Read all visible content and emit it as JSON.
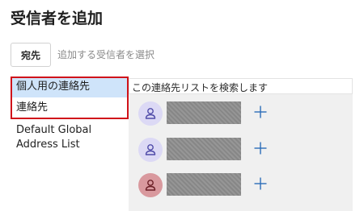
{
  "dialog": {
    "title": "受信者を追加"
  },
  "recipient": {
    "to_label": "宛先",
    "placeholder": "追加する受信者を選択"
  },
  "address_books": [
    {
      "label": "個人用の連絡先",
      "selected": true
    },
    {
      "label": "連絡先",
      "selected": false
    },
    {
      "label": "Default Global Address List",
      "selected": false
    }
  ],
  "search": {
    "placeholder": "この連絡先リストを検索します"
  },
  "contacts": [
    {
      "avatar_color": "#dcd9f5",
      "icon_color": "#4f4aa8",
      "icon": "person-icon"
    },
    {
      "avatar_color": "#dcd9f5",
      "icon_color": "#4f4aa8",
      "icon": "person-icon"
    },
    {
      "avatar_color": "#d9999e",
      "icon_color": "#6b1f26",
      "icon": "person-icon"
    }
  ],
  "colors": {
    "selected_bg": "#cfe4fa",
    "highlight_border": "#d0131a",
    "add_icon": "#2b6cb8",
    "panel_bg": "#f0f0f0"
  }
}
